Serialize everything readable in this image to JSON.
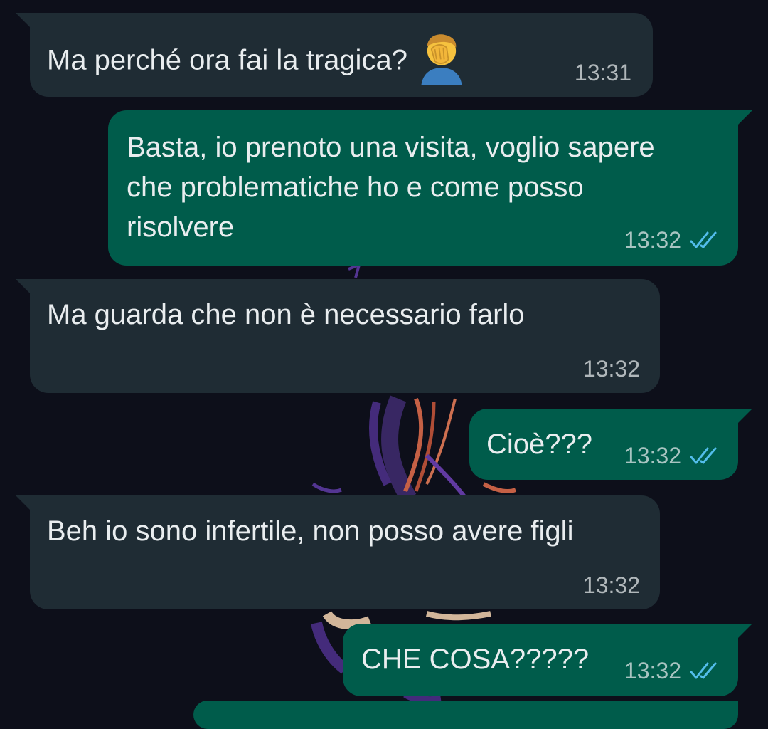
{
  "colors": {
    "background": "#0d0f1a",
    "incoming_bubble": "#1f2c34",
    "outgoing_bubble": "#005c4b",
    "text": "#e9edef",
    "read_ticks": "#53bdeb"
  },
  "messages": [
    {
      "direction": "incoming",
      "text": "Ma perché ora fai la tragica?",
      "emoji": "man-facepalming-icon",
      "time": "13:31"
    },
    {
      "direction": "outgoing",
      "text": "Basta, io prenoto una visita, voglio sapere che problematiche ho e come posso risolvere",
      "time": "13:32",
      "status": "read"
    },
    {
      "direction": "incoming",
      "text": "Ma guarda che non è necessario farlo",
      "time": "13:32"
    },
    {
      "direction": "outgoing",
      "text": "Cioè???",
      "time": "13:32",
      "status": "read"
    },
    {
      "direction": "incoming",
      "text": "Beh io sono infertile, non posso avere figli",
      "time": "13:32"
    },
    {
      "direction": "outgoing",
      "text": "CHE COSA?????",
      "time": "13:32",
      "status": "read"
    }
  ]
}
